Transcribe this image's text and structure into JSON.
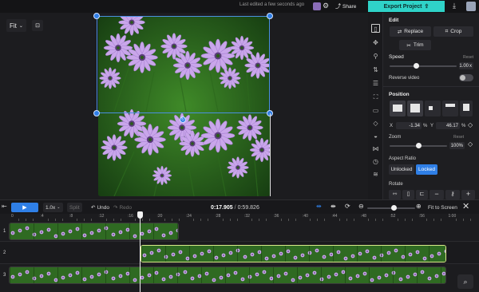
{
  "topbar": {
    "status": "Last edited a few seconds ago",
    "share_label": "Share",
    "export_label": "Export Project",
    "icons": [
      "avatar-icon",
      "gear-icon",
      "download-icon"
    ]
  },
  "canvas": {
    "fit_label": "Fit",
    "image_alt": "Purple daisy flowers on green background"
  },
  "panel": {
    "edit": {
      "title": "Edit",
      "replace_label": "Replace",
      "crop_label": "Crop",
      "trim_label": "Trim"
    },
    "speed": {
      "title": "Speed",
      "reset_label": "Reset",
      "value": "1.00",
      "unit": "x",
      "level": 0.4
    },
    "reverse": {
      "label": "Reverse video",
      "on": false
    },
    "position": {
      "title": "Position",
      "x_label": "X",
      "x_value": "-1.34",
      "x_unit": "%",
      "y_label": "Y",
      "y_value": "46.17",
      "y_unit": "%"
    },
    "zoom": {
      "title": "Zoom",
      "reset_label": "Reset",
      "value": "100%",
      "level": 0.5
    },
    "aspect": {
      "title": "Aspect Ratio",
      "unlocked_label": "Unlocked",
      "locked_label": "Locked"
    },
    "rotate": {
      "title": "Rotate"
    }
  },
  "timeline": {
    "play_label": "▶",
    "speed_label": "1.0x",
    "split_label": "Split",
    "undo_label": "Undo",
    "redo_label": "Redo",
    "time_current": "0:17.905",
    "time_total": "0:59.826",
    "fit_screen_label": "Fit to Screen",
    "ruler_ticks": [
      "0",
      ":4",
      ":8",
      ":12",
      ":16",
      ":20",
      ":24",
      ":28",
      ":32",
      ":36",
      ":40",
      ":44",
      ":48",
      ":52",
      ":56",
      "1:00"
    ],
    "tracks": [
      "1",
      "2",
      "3"
    ],
    "zoom_level": 0.55
  },
  "colors": {
    "accent": "#2f7fe6",
    "export": "#2fd3c8",
    "selected_clip": "#d9ea8a"
  }
}
